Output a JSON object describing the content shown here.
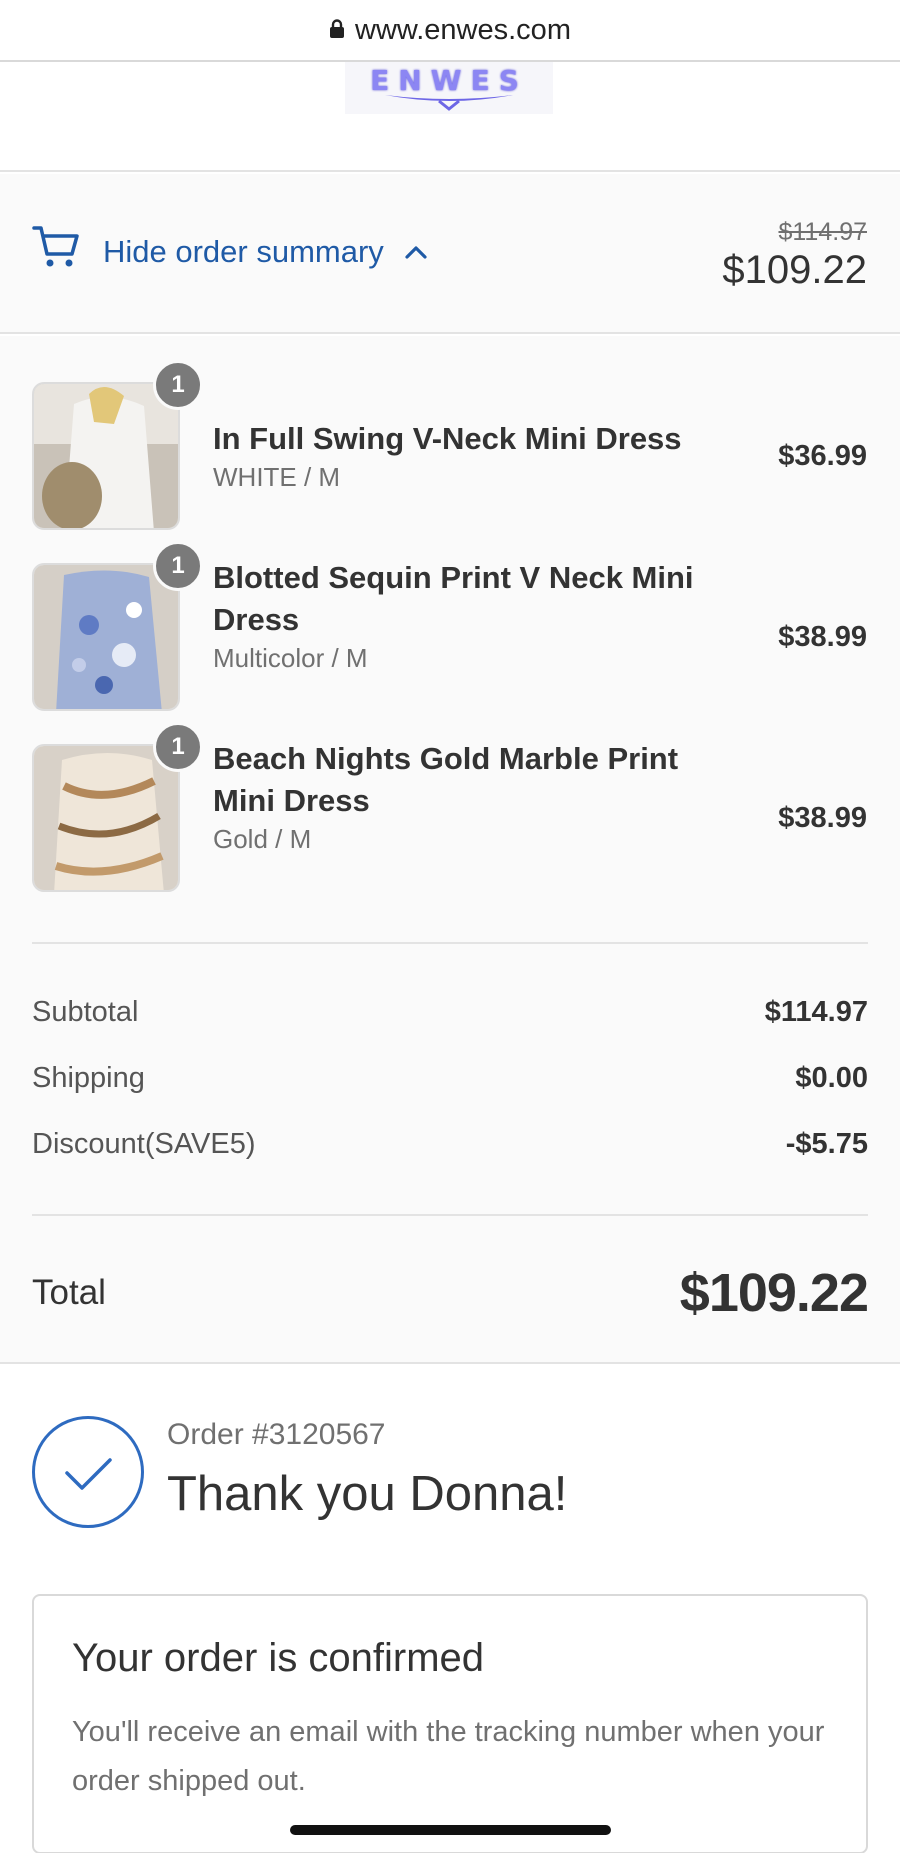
{
  "browser": {
    "url": "www.enwes.com",
    "lock_icon": "lock-icon"
  },
  "logo": {
    "text": "ENWES",
    "color": "#8c86f3"
  },
  "summary": {
    "toggle_label": "Hide order summary",
    "cart_icon": "cart-icon",
    "chevron_icon": "chevron-up-icon",
    "original_price": "$114.97",
    "current_price": "$109.22",
    "accent": "#1f5aa6"
  },
  "items": [
    {
      "quantity": "1",
      "name": "In Full Swing V-Neck Mini Dress",
      "variant": "WHITE / M",
      "price": "$36.99"
    },
    {
      "quantity": "1",
      "name": "Blotted Sequin Print V Neck Mini Dress",
      "variant": "Multicolor / M",
      "price": "$38.99"
    },
    {
      "quantity": "1",
      "name": "Beach Nights Gold Marble Print Mini Dress",
      "variant": "Gold / M",
      "price": "$38.99"
    }
  ],
  "totals": {
    "subtotal_label": "Subtotal",
    "subtotal": "$114.97",
    "shipping_label": "Shipping",
    "shipping": "$0.00",
    "discount_label": "Discount(SAVE5)",
    "discount": "-$5.75",
    "total_label": "Total",
    "total": "$109.22"
  },
  "confirmation": {
    "check_icon": "checkmark-circle-icon",
    "order_number": "Order #3120567",
    "thanks": "Thank you Donna!",
    "box_title": "Your order is confirmed",
    "box_text": "You'll receive an email with the tracking number when your order shipped out."
  }
}
